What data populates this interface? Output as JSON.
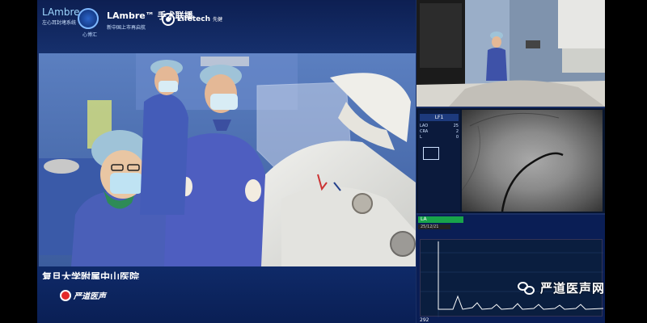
{
  "header": {
    "lambre_brand": "LAmbre",
    "lambre_sub": "左心耳封堵系统",
    "badge_text": "心博汇",
    "live_title": "LAmbre™ 手术联播",
    "live_sub": "新中国上市再启航",
    "lifetech_name": "Lifetech",
    "lifetech_cn": "先健"
  },
  "lower_third": {
    "hospital_title": "复旦大学附属中山医院",
    "channel_name": "严道医声"
  },
  "fluoro_panel": {
    "tag": "LF1",
    "rows": [
      {
        "k": "LAO",
        "v": "25"
      },
      {
        "k": "CRA",
        "v": "2"
      },
      {
        "k": "L",
        "v": "0"
      }
    ]
  },
  "hemo_panel": {
    "channel_label": "LA",
    "time_readout": "25/12/21",
    "footer_value": "292"
  },
  "watermark": {
    "text": "严道医声网"
  },
  "colors": {
    "frame_blue": "#1a2f63",
    "hemo_green": "#18a34a",
    "scrub_blue": "#4a5fb8"
  }
}
